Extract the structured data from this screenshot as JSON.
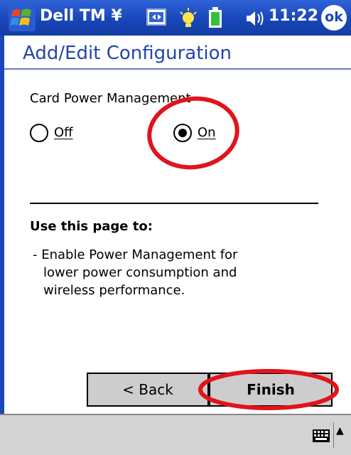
{
  "titlebar": {
    "app_title": "Dell TM ¥",
    "clock": "11:22",
    "ok_label": "ok",
    "icons": [
      "windows-start-icon",
      "sync-icon",
      "notification-icon",
      "battery-icon",
      "speaker-icon"
    ]
  },
  "page": {
    "title": "Add/Edit Configuration"
  },
  "power": {
    "section_label": "Card Power Management",
    "options": [
      {
        "label": "Off",
        "selected": false
      },
      {
        "label": "On",
        "selected": true
      }
    ]
  },
  "help": {
    "heading": "Use this page to:",
    "lines": [
      "- Enable Power Management for",
      "lower power consumption and",
      "wireless performance."
    ]
  },
  "buttons": {
    "back": "< Back",
    "finish": "Finish"
  },
  "colors": {
    "titlebar": "#1846b8",
    "title_text": "#2346a8",
    "annotation": "#e0141b",
    "button_face": "#cdcdcd"
  }
}
